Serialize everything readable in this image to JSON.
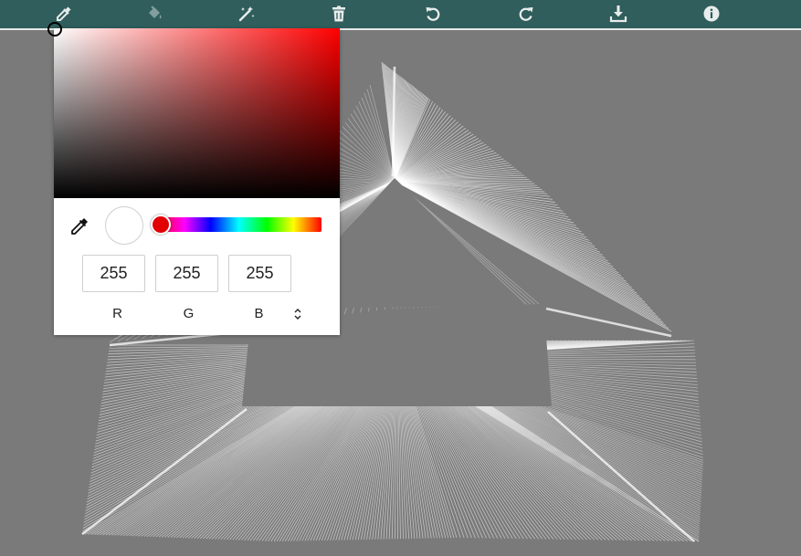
{
  "toolbar": {
    "background": "#2f5e5c",
    "icon_color": "#e8ecec",
    "tools": [
      {
        "name": "eyedropper-icon",
        "state": "active"
      },
      {
        "name": "paint-bucket-icon",
        "state": "disabled"
      },
      {
        "name": "magic-wand-icon",
        "state": "active"
      },
      {
        "name": "trash-icon",
        "state": "active"
      },
      {
        "name": "undo-icon",
        "state": "active"
      },
      {
        "name": "redo-icon",
        "state": "active"
      },
      {
        "name": "download-icon",
        "state": "active"
      },
      {
        "name": "info-icon",
        "state": "active"
      }
    ]
  },
  "canvas": {
    "background": "#7a7a7a",
    "stroke_color": "#ffffff"
  },
  "color_picker": {
    "hue_color": "#ff0000",
    "selected_color": "#ffffff",
    "hue_position": 0,
    "channels": [
      {
        "label": "R",
        "value": "255"
      },
      {
        "label": "G",
        "value": "255"
      },
      {
        "label": "B",
        "value": "255"
      }
    ],
    "icons": {
      "eyedropper": "eyedropper-icon",
      "mode_toggle": "up-down-chevron-icon"
    }
  }
}
